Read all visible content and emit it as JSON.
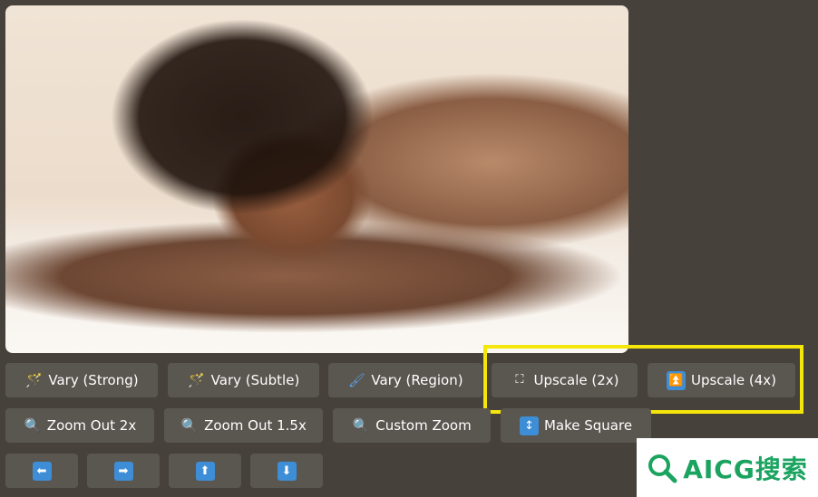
{
  "image": {
    "description_icon": "generated-image"
  },
  "row1": [
    {
      "label": "Vary (Strong)",
      "icon": "magic-wand-icon"
    },
    {
      "label": "Vary (Subtle)",
      "icon": "magic-wand-icon"
    },
    {
      "label": "Vary (Region)",
      "icon": "paintbrush-icon"
    },
    {
      "label": "Upscale (2x)",
      "icon": "expand-corners-icon"
    },
    {
      "label": "Upscale (4x)",
      "icon": "double-up-arrow-icon"
    }
  ],
  "row2": [
    {
      "label": "Zoom Out 2x",
      "icon": "magnifier-icon"
    },
    {
      "label": "Zoom Out 1.5x",
      "icon": "magnifier-icon"
    },
    {
      "label": "Custom Zoom",
      "icon": "magnifier-icon"
    },
    {
      "label": "Make Square",
      "icon": "up-down-arrow-icon"
    }
  ],
  "row3": [
    {
      "glyph": "⬅",
      "icon": "arrow-left-icon"
    },
    {
      "glyph": "➡",
      "icon": "arrow-right-icon"
    },
    {
      "glyph": "⬆",
      "icon": "arrow-up-icon"
    },
    {
      "glyph": "⬇",
      "icon": "arrow-down-icon"
    }
  ],
  "icons": {
    "wand": "🪄",
    "brush": "🖌",
    "magnifier": "🔍",
    "corners": "⛶",
    "double_up": "⏫",
    "up_down": "↕"
  },
  "watermark": {
    "text": "AICG搜索"
  },
  "colors": {
    "background": "#46413b",
    "button": "#5a5650",
    "highlight": "#f4e60a",
    "accent_blue": "#3d8ed6",
    "watermark_green": "#1ba360"
  }
}
